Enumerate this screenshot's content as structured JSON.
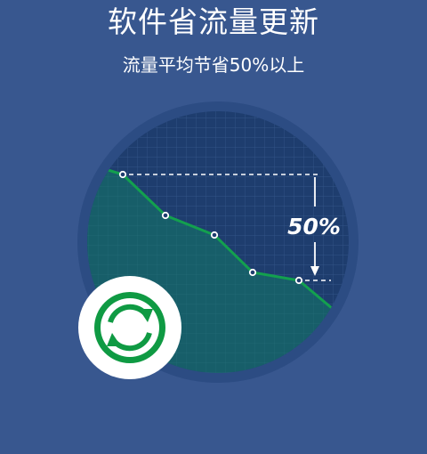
{
  "header": {
    "title": "软件省流量更新",
    "subtitle": "流量平均节省50%以上"
  },
  "graphic": {
    "savings_label": "50%",
    "update_icon": "sync-icon",
    "colors": {
      "background": "#38578f",
      "disc_outer": "#2c4c83",
      "disc_inner": "#1e3d6e",
      "trend_line": "#13a04e",
      "badge": "#ffffff",
      "sync_green": "#0f9a43"
    }
  }
}
